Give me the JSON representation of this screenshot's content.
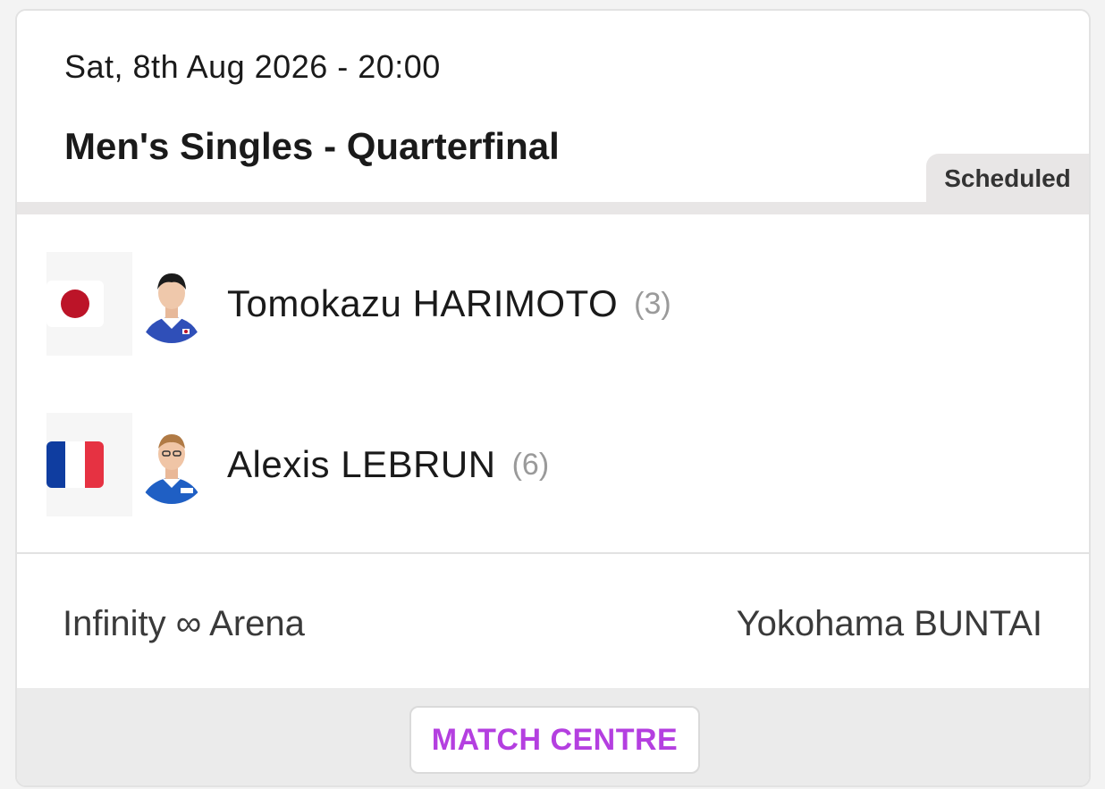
{
  "match": {
    "datetime": "Sat, 8th Aug 2026 - 20:00",
    "event": "Men's Singles - Quarterfinal",
    "status": "Scheduled"
  },
  "players": [
    {
      "name": "Tomokazu HARIMOTO",
      "seed": "(3)",
      "country_flag": "flag-japan-icon",
      "flag_colors": [
        "#ffffff",
        "#bc1428"
      ]
    },
    {
      "name": "Alexis LEBRUN",
      "seed": "(6)",
      "country_flag": "flag-france-icon",
      "flag_colors": [
        "#0f3da0",
        "#ffffff",
        "#e63242"
      ]
    }
  ],
  "location": {
    "venue": "Infinity ∞ Arena",
    "city": "Yokohama BUNTAI"
  },
  "footer": {
    "cta_label": "MATCH CENTRE"
  },
  "colors": {
    "accent": "#b43fe0",
    "badge_bg": "#e8e6e6"
  }
}
